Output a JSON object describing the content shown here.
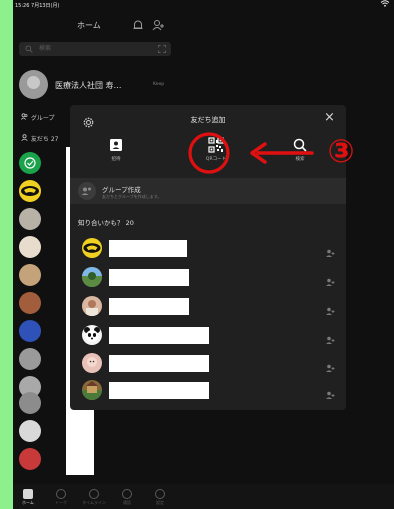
{
  "status_bar": {
    "time": "15:26",
    "date": "7月13日(月)",
    "wifi": "wifi-icon"
  },
  "header": {
    "title": "ホーム",
    "icons": [
      "bell-icon",
      "add-friend-icon"
    ]
  },
  "search": {
    "placeholder": "検索"
  },
  "profile": {
    "name": "医療法人社団 寿…",
    "keep": "Keep"
  },
  "left_sections": {
    "groups": "グループ",
    "friends": "友だち 27"
  },
  "modal": {
    "title": "友だち追加",
    "options": [
      {
        "label": "招待",
        "icon": "invite-icon"
      },
      {
        "label": "QRコード",
        "icon": "qr-code-icon"
      },
      {
        "label": "検索",
        "icon": "search-icon"
      }
    ],
    "group_create": {
      "title": "グループ作成",
      "subtitle": "友だちとグループを作成します。"
    },
    "suggestions_header": "知り合いかも？ 20"
  },
  "bottom_nav": [
    "ホーム",
    "トーク",
    "タイムライン",
    "通話",
    "設定"
  ],
  "annotation": {
    "number": "③",
    "color": "#e01010"
  },
  "colors": {
    "background": "#101010",
    "modal": "#202020",
    "accent_green": "#1aa34a",
    "annotation_red": "#e01010"
  }
}
